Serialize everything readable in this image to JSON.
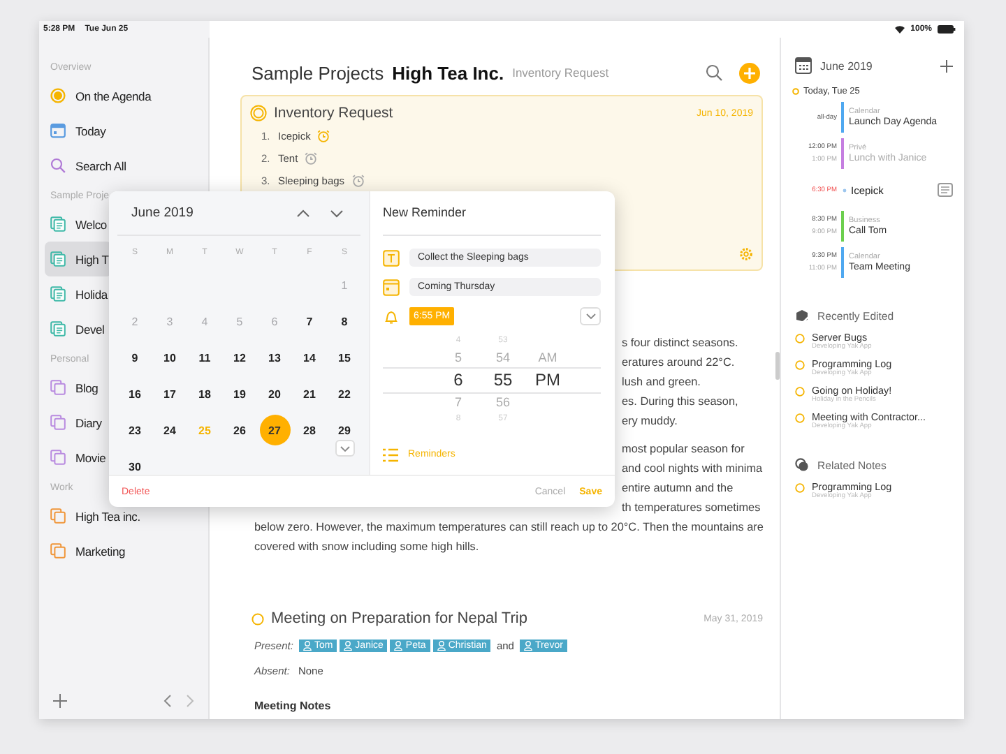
{
  "status_bar": {
    "time": "5:28 PM",
    "date": "Tue Jun 25",
    "battery": "100%"
  },
  "sidebar": {
    "sections": [
      {
        "title": "Overview",
        "items": [
          {
            "label": "On the Agenda",
            "kind": "agenda",
            "color": "#f5b400",
            "selected": false
          },
          {
            "label": "Today",
            "kind": "today",
            "color": "#5a9be0",
            "selected": false
          },
          {
            "label": "Search All",
            "kind": "search",
            "color": "#b07ad6",
            "selected": false
          }
        ]
      },
      {
        "title": "Sample Proje",
        "items": [
          {
            "label": "Welco",
            "kind": "project",
            "color": "#3fb9a8",
            "selected": false
          },
          {
            "label": "High T",
            "kind": "project",
            "color": "#3fb9a8",
            "selected": true
          },
          {
            "label": "Holida",
            "kind": "project",
            "color": "#3fb9a8",
            "selected": false
          },
          {
            "label": "Devel",
            "kind": "project",
            "color": "#3fb9a8",
            "selected": false
          }
        ]
      },
      {
        "title": "Personal",
        "items": [
          {
            "label": "Blog",
            "kind": "notebook",
            "color": "#b98be0",
            "selected": false
          },
          {
            "label": "Diary",
            "kind": "notebook",
            "color": "#b98be0",
            "selected": false
          },
          {
            "label": "Movie",
            "kind": "notebook",
            "color": "#b98be0",
            "selected": false
          }
        ]
      },
      {
        "title": "Work",
        "items": [
          {
            "label": "High Tea inc.",
            "kind": "notebook",
            "color": "#f0963a",
            "selected": false
          },
          {
            "label": "Marketing",
            "kind": "notebook",
            "color": "#f0963a",
            "selected": false
          }
        ]
      }
    ]
  },
  "header": {
    "path": "Sample Projects",
    "title": "High Tea Inc.",
    "subtitle": "Inventory Request"
  },
  "card": {
    "title": "Inventory Request",
    "date": "Jun 10, 2019",
    "items": [
      {
        "number": "1.",
        "label": "Icepick",
        "alarm_on": true
      },
      {
        "number": "2.",
        "label": "Tent",
        "alarm_on": false
      },
      {
        "number": "3.",
        "label": "Sleeping bags",
        "alarm_on": false
      }
    ]
  },
  "body": {
    "paragraphs": [
      {
        "lines": [
          {
            "kind": "cut",
            "text": "s four distinct seasons."
          },
          {
            "kind": "cut",
            "text": "eratures around 22°C."
          },
          {
            "kind": "cut",
            "text": "lush and green."
          },
          {
            "kind": "cut",
            "text": "es. During this season,"
          },
          {
            "kind": "cut",
            "text": "ery muddy."
          }
        ]
      },
      {
        "lines": [
          {
            "kind": "cut",
            "text": "most popular season for"
          },
          {
            "kind": "cut",
            "text": "and cool nights with minima"
          },
          {
            "kind": "cut",
            "text": "entire autumn and the"
          },
          {
            "kind": "cut",
            "text": "th temperatures sometimes"
          },
          {
            "kind": "full",
            "text": "below zero. However, the maximum temperatures can still reach up to 20°C. Then the mountains are"
          },
          {
            "kind": "full",
            "text": "covered with snow including some high hills."
          }
        ]
      }
    ]
  },
  "meeting": {
    "title": "Meeting on Preparation for Nepal Trip",
    "date": "May 31, 2019",
    "present_label": "Present:",
    "present": [
      {
        "kind": "tag",
        "label": "Tom"
      },
      {
        "kind": "tag",
        "label": "Janice"
      },
      {
        "kind": "tag",
        "label": "Peta"
      },
      {
        "kind": "tag",
        "label": "Christian"
      },
      {
        "kind": "word",
        "label": "and"
      },
      {
        "kind": "tag",
        "label": "Trevor"
      }
    ],
    "absent_label": "Absent:",
    "absent": "None",
    "notes_heading": "Meeting Notes"
  },
  "popup": {
    "calendar": {
      "title": "June 2019",
      "weekdays": [
        "S",
        "M",
        "T",
        "W",
        "T",
        "F",
        "S"
      ],
      "days": [
        {
          "kind": "blank"
        },
        {
          "kind": "blank"
        },
        {
          "kind": "blank"
        },
        {
          "kind": "blank"
        },
        {
          "kind": "blank"
        },
        {
          "kind": "blank"
        },
        {
          "kind": "day",
          "label": "1",
          "past": true,
          "today": false,
          "selected": false
        },
        {
          "kind": "day",
          "label": "2",
          "past": true,
          "today": false,
          "selected": false
        },
        {
          "kind": "day",
          "label": "3",
          "past": true,
          "today": false,
          "selected": false
        },
        {
          "kind": "day",
          "label": "4",
          "past": true,
          "today": false,
          "selected": false
        },
        {
          "kind": "day",
          "label": "5",
          "past": true,
          "today": false,
          "selected": false
        },
        {
          "kind": "day",
          "label": "6",
          "past": true,
          "today": false,
          "selected": false
        },
        {
          "kind": "day",
          "label": "7",
          "past": false,
          "today": false,
          "selected": false
        },
        {
          "kind": "day",
          "label": "8",
          "past": false,
          "today": false,
          "selected": false
        },
        {
          "kind": "day",
          "label": "9",
          "past": false,
          "today": false,
          "selected": false
        },
        {
          "kind": "day",
          "label": "10",
          "past": false,
          "today": false,
          "selected": false
        },
        {
          "kind": "day",
          "label": "11",
          "past": false,
          "today": false,
          "selected": false
        },
        {
          "kind": "day",
          "label": "12",
          "past": false,
          "today": false,
          "selected": false
        },
        {
          "kind": "day",
          "label": "13",
          "past": false,
          "today": false,
          "selected": false
        },
        {
          "kind": "day",
          "label": "14",
          "past": false,
          "today": false,
          "selected": false
        },
        {
          "kind": "day",
          "label": "15",
          "past": false,
          "today": false,
          "selected": false
        },
        {
          "kind": "day",
          "label": "16",
          "past": false,
          "today": false,
          "selected": false
        },
        {
          "kind": "day",
          "label": "17",
          "past": false,
          "today": false,
          "selected": false
        },
        {
          "kind": "day",
          "label": "18",
          "past": false,
          "today": false,
          "selected": false
        },
        {
          "kind": "day",
          "label": "19",
          "past": false,
          "today": false,
          "selected": false
        },
        {
          "kind": "day",
          "label": "20",
          "past": false,
          "today": false,
          "selected": false
        },
        {
          "kind": "day",
          "label": "21",
          "past": false,
          "today": false,
          "selected": false
        },
        {
          "kind": "day",
          "label": "22",
          "past": false,
          "today": false,
          "selected": false
        },
        {
          "kind": "day",
          "label": "23",
          "past": false,
          "today": false,
          "selected": false
        },
        {
          "kind": "day",
          "label": "24",
          "past": false,
          "today": false,
          "selected": false
        },
        {
          "kind": "day",
          "label": "25",
          "past": false,
          "today": true,
          "selected": false
        },
        {
          "kind": "day",
          "label": "26",
          "past": false,
          "today": false,
          "selected": false
        },
        {
          "kind": "day",
          "label": "27",
          "past": false,
          "today": false,
          "selected": true
        },
        {
          "kind": "day",
          "label": "28",
          "past": false,
          "today": false,
          "selected": false
        },
        {
          "kind": "day",
          "label": "29",
          "past": false,
          "today": false,
          "selected": false
        },
        {
          "kind": "day",
          "label": "30",
          "past": false,
          "today": false,
          "selected": false
        }
      ]
    },
    "reminder": {
      "title": "New Reminder",
      "fields": [
        {
          "kind": "text",
          "value": "Collect the Sleeping bags"
        },
        {
          "kind": "date",
          "value": "Coming Thursday"
        }
      ],
      "alarm_time": "6:55 PM",
      "wheels": [
        {
          "items": [
            {
              "label": "4",
              "selected": false
            },
            {
              "label": "5",
              "selected": false
            },
            {
              "label": "6",
              "selected": true
            },
            {
              "label": "7",
              "selected": false
            },
            {
              "label": "8",
              "selected": false
            }
          ]
        },
        {
          "items": [
            {
              "label": "53",
              "selected": false
            },
            {
              "label": "54",
              "selected": false
            },
            {
              "label": "55",
              "selected": true
            },
            {
              "label": "56",
              "selected": false
            },
            {
              "label": "57",
              "selected": false
            }
          ]
        },
        {
          "items": [
            {
              "label": "AM",
              "selected": false
            },
            {
              "label": "PM",
              "selected": true
            }
          ]
        }
      ],
      "list_link": "Reminders"
    },
    "actions": {
      "delete": "Delete",
      "cancel": "Cancel",
      "save": "Save"
    }
  },
  "agenda": {
    "month": "June 2019",
    "today": "Today, Tue 25",
    "events": [
      {
        "kind": "event",
        "start": "all-day",
        "calendar": "Calendar",
        "title": "Launch Day Agenda",
        "color": "#4fa8f0",
        "past": false
      },
      {
        "kind": "event",
        "start": "12:00 PM",
        "end": "1:00 PM",
        "calendar": "Privé",
        "title": "Lunch with Janice",
        "color": "#c57ee0",
        "past": true
      },
      {
        "kind": "reminder",
        "start": "6:30 PM",
        "title": "Icepick"
      },
      {
        "kind": "event",
        "start": "8:30 PM",
        "end": "9:00 PM",
        "calendar": "Business",
        "title": "Call Tom",
        "color": "#6ccf4e",
        "past": false
      },
      {
        "kind": "event",
        "start": "9:30 PM",
        "end": "11:00 PM",
        "calendar": "Calendar",
        "title": "Team Meeting",
        "color": "#4fa8f0",
        "past": false
      }
    ]
  },
  "recently_edited": {
    "title": "Recently Edited",
    "items": [
      {
        "title": "Server Bugs",
        "subtitle": "Developing Yak App"
      },
      {
        "title": "Programming Log",
        "subtitle": "Developing Yak App"
      },
      {
        "title": "Going on Holiday!",
        "subtitle": "Holiday in the Pencils"
      },
      {
        "title": "Meeting with Contractor...",
        "subtitle": "Developing Yak App"
      }
    ]
  },
  "related_notes": {
    "title": "Related Notes",
    "items": [
      {
        "title": "Programming Log",
        "subtitle": "Developing Yak App"
      }
    ]
  }
}
